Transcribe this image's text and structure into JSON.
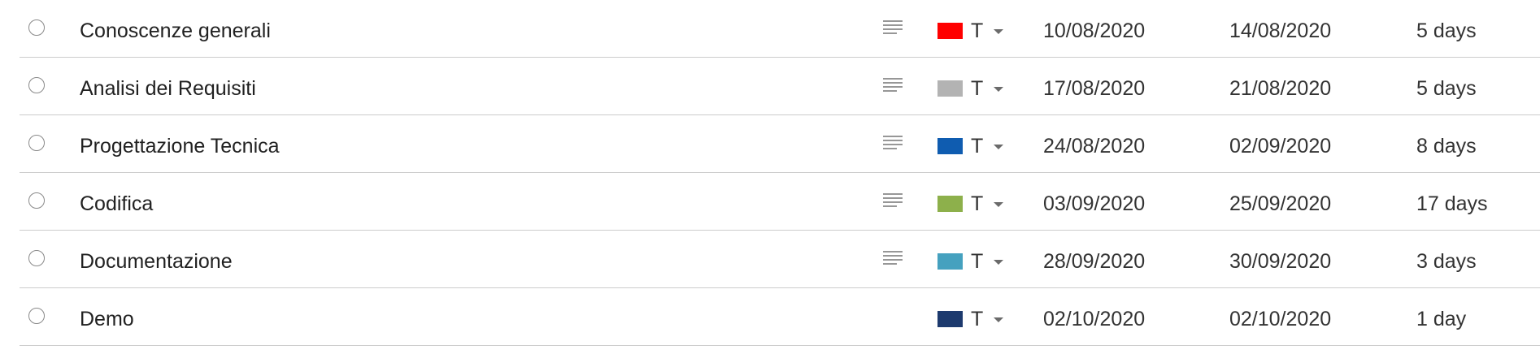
{
  "tasks": [
    {
      "name": "Conoscenze generali",
      "has_notes": true,
      "color": "#ff0000",
      "color_letter": "T",
      "start": "10/08/2020",
      "end": "14/08/2020",
      "duration": "5 days"
    },
    {
      "name": "Analisi dei Requisiti",
      "has_notes": true,
      "color": "#b3b3b3",
      "color_letter": "T",
      "start": "17/08/2020",
      "end": "21/08/2020",
      "duration": "5 days"
    },
    {
      "name": "Progettazione Tecnica",
      "has_notes": true,
      "color": "#0f5cb0",
      "color_letter": "T",
      "start": "24/08/2020",
      "end": "02/09/2020",
      "duration": "8 days"
    },
    {
      "name": "Codifica",
      "has_notes": true,
      "color": "#8db04b",
      "color_letter": "T",
      "start": "03/09/2020",
      "end": "25/09/2020",
      "duration": "17 days"
    },
    {
      "name": "Documentazione",
      "has_notes": true,
      "color": "#45a1bf",
      "color_letter": "T",
      "start": "28/09/2020",
      "end": "30/09/2020",
      "duration": "3 days"
    },
    {
      "name": "Demo",
      "has_notes": false,
      "color": "#1d3a6e",
      "color_letter": "T",
      "start": "02/10/2020",
      "end": "02/10/2020",
      "duration": "1 day"
    }
  ],
  "icons": {
    "status": "radio-circle-icon",
    "notes": "notes-lines-icon",
    "dropdown": "caret-down-icon"
  }
}
